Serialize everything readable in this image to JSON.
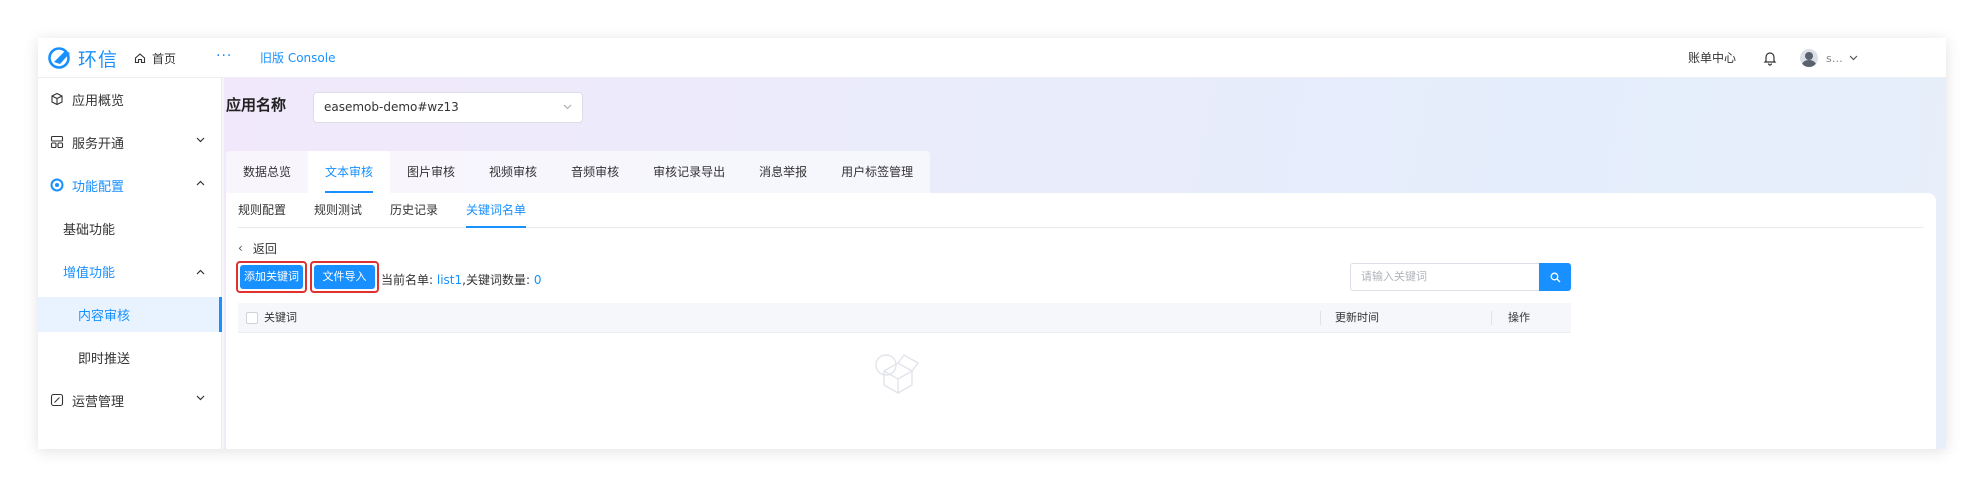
{
  "topbar": {
    "logo_text": "环信",
    "home_label": "首页",
    "more": "···",
    "console_label": "旧版 Console",
    "billing_label": "账单中心",
    "username": "s…"
  },
  "sidebar": {
    "items": [
      {
        "label": "应用概览",
        "icon": "cube-icon"
      },
      {
        "label": "服务开通",
        "icon": "services-icon"
      },
      {
        "label": "功能配置",
        "icon": "settings-circle-icon"
      },
      {
        "label": "基础功能"
      },
      {
        "label": "增值功能"
      },
      {
        "label": "内容审核"
      },
      {
        "label": "即时推送"
      },
      {
        "label": "运营管理",
        "icon": "edit-square-icon"
      }
    ]
  },
  "main": {
    "app_label": "应用名称",
    "app_select_value": "easemob-demo#wz13",
    "tabs": [
      "数据总览",
      "文本审核",
      "图片审核",
      "视频审核",
      "音频审核",
      "审核记录导出",
      "消息举报",
      "用户标签管理"
    ],
    "active_tab_index": 1,
    "subtabs": [
      "规则配置",
      "规则测试",
      "历史记录",
      "关键词名单"
    ],
    "active_subtab_index": 3,
    "back_label": "返回",
    "add_keyword_label": "添加关键词",
    "file_import_label": "文件导入",
    "current_list_prefix": "当前名单:",
    "current_list_value": "list1",
    "keyword_count_prefix": ",关键词数量:",
    "keyword_count_value": "0",
    "search_placeholder": "请输入关键词",
    "table_columns": [
      "关键词",
      "更新时间",
      "操作"
    ]
  },
  "colors": {
    "accent": "#1890ff",
    "highlight_border": "#e03131"
  }
}
